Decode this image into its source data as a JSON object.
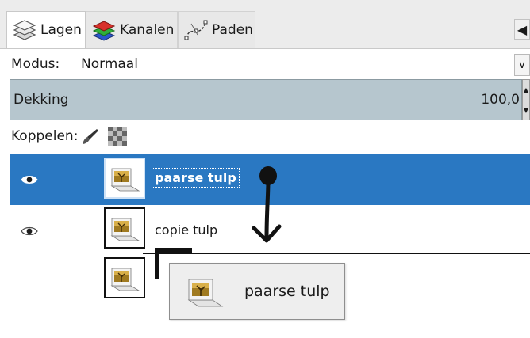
{
  "tabs": [
    {
      "label": "Lagen",
      "icon": "layers-icon"
    },
    {
      "label": "Kanalen",
      "icon": "channels-icon"
    },
    {
      "label": "Paden",
      "icon": "paths-icon"
    }
  ],
  "mode": {
    "label": "Modus:",
    "value": "Normaal"
  },
  "opacity": {
    "label": "Dekking",
    "value": "100,0"
  },
  "lock": {
    "label": "Koppelen:",
    "icons": [
      "paint-lock-icon",
      "alpha-lock-icon"
    ]
  },
  "layers": [
    {
      "name": "paarse tulp",
      "visible": true,
      "selected": true
    },
    {
      "name": "copie tulp",
      "visible": true,
      "selected": false
    },
    {
      "name": "",
      "visible": false,
      "selected": false
    }
  ],
  "drag": {
    "label": "paarse tulp",
    "icon": "layer-thumbnail-icon"
  },
  "colors": {
    "selection": "#2a78c2",
    "slider": "#b6c6ce",
    "annotation": "#111111"
  }
}
